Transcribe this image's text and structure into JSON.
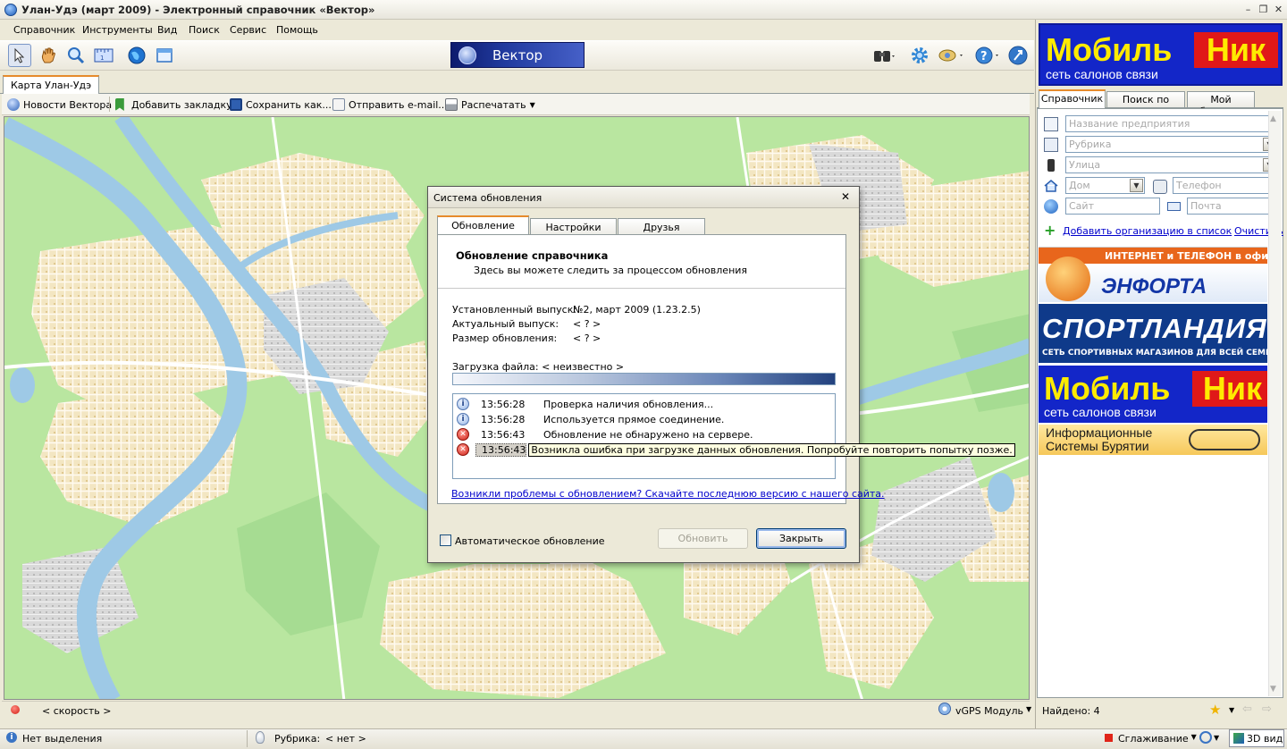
{
  "window": {
    "title": "Улан-Удэ (март 2009) - Электронный справочник «Вектор»"
  },
  "menu": [
    "Справочник",
    "Инструменты",
    "Вид",
    "Поиск",
    "Сервис",
    "Помощь"
  ],
  "toolbar": {
    "brand": "Вектор"
  },
  "map_tab": "Карта Улан-Удэ",
  "map_toolbar": {
    "news": "Новости Вектора",
    "bookmark": "Добавить закладку",
    "save": "Сохранить как...",
    "email": "Отправить e-mail...",
    "print": "Распечатать"
  },
  "map_status": {
    "speed": "< скорость >",
    "gps": "vGPS Модуль"
  },
  "status_bar": {
    "selection": "Нет выделения",
    "rubric_label": "Рубрика:",
    "rubric_value": "< нет >",
    "smoothing": "Сглаживание",
    "view3d": "3D вид"
  },
  "right_panel": {
    "ads": {
      "mobilnik_1": "Мобиль",
      "mobilnik_2": "Ник",
      "mobilnik_sub": "сеть салонов связи",
      "enforta_top": "ИНТЕРНЕТ и ТЕЛЕФОН в офис",
      "enforta_name": "ЭНФОРТА",
      "sport_name": "СПОРТЛАНДИЯ",
      "sport_sub": "СЕТЬ СПОРТИВНЫХ МАГАЗИНОВ ДЛЯ ВСЕЙ СЕМЬИ",
      "isb_line1": "Информационные",
      "isb_line2": "Системы Бурятии"
    },
    "tabs": [
      "Справочник",
      "Поиск по карте",
      "Мой блокнот"
    ],
    "fields": {
      "company": "Название предприятия",
      "rubric": "Рубрика",
      "street": "Улица",
      "house": "Дом",
      "phone": "Телефон",
      "site": "Сайт",
      "mail": "Почта"
    },
    "add_org": "Добавить организацию в список",
    "clear": "Очистить",
    "found": "Найдено: 4"
  },
  "dialog": {
    "title": "Система обновления",
    "tabs": [
      "Обновление",
      "Настройки",
      "Друзья"
    ],
    "heading": "Обновление справочника",
    "subheading": "Здесь вы можете следить за процессом обновления",
    "installed_label": "Установленный выпуск:",
    "installed_value": "№2, март 2009 (1.23.2.5)",
    "actual_label": "Актуальный выпуск:",
    "actual_value": "< ? >",
    "size_label": "Размер обновления:",
    "size_value": "< ? >",
    "download_label": "Загрузка файла: < неизвестно >",
    "progress": 1.0,
    "log": [
      {
        "type": "info",
        "time": "13:56:28",
        "message": "Проверка наличия обновления..."
      },
      {
        "type": "info",
        "time": "13:56:28",
        "message": "Используется прямое соединение."
      },
      {
        "type": "error",
        "time": "13:56:43",
        "message": "Обновление не обнаружено на сервере."
      },
      {
        "type": "error",
        "time": "13:56:43",
        "message": "Возникла ошибка при загрузке данных обновления. Попробуйте повторить попытку позже."
      }
    ],
    "link": "Возникли проблемы с обновлением? Скачайте последнюю версию с нашего сайта.",
    "auto_update_label": "Автоматическое обновление",
    "auto_update_checked": false,
    "update_button": "Обновить",
    "close_button": "Закрыть"
  }
}
